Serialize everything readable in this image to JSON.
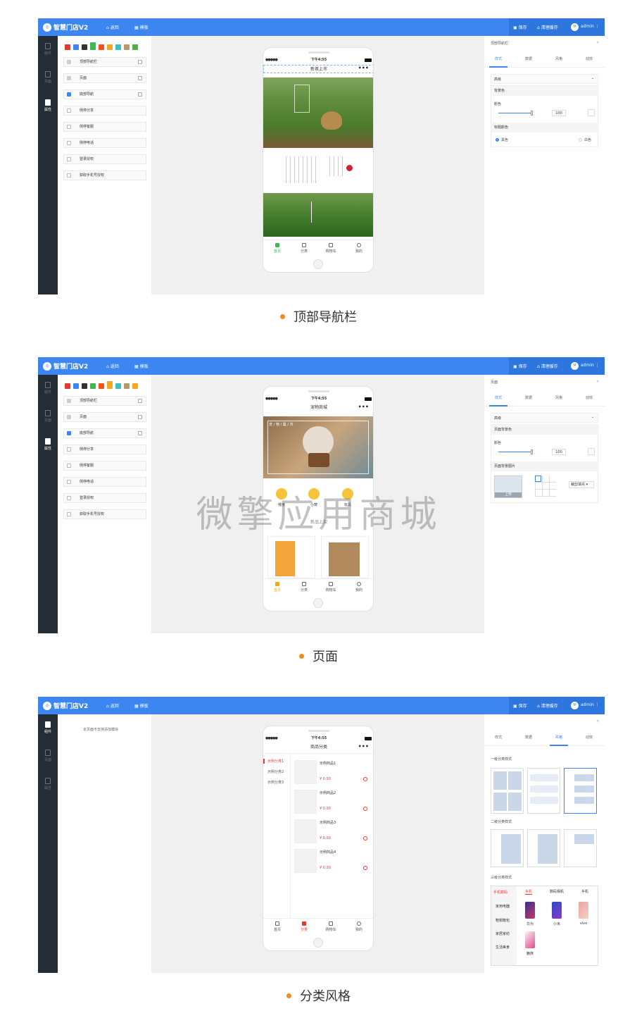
{
  "app": {
    "logo": "智慧门店V2",
    "nav_back": "返回",
    "nav_template": "模板",
    "save": "保存",
    "clear_cache": "清理缓存",
    "user": "admin"
  },
  "sidebar": {
    "components": "组件",
    "page": "页面",
    "properties": "属性"
  },
  "swatches": [
    "#e03b2d",
    "#3d86f1",
    "#333333",
    "#3fb84f",
    "#f2531e",
    "#f5a623",
    "#3dc1bf",
    "#8bc34a",
    "#b59a6d",
    "#4caf50"
  ],
  "options": [
    "顶部导航栏",
    "页面",
    "底部导航",
    "侧停分享",
    "侧停客服",
    "侧停电话",
    "登录授权",
    "获取手机号授权"
  ],
  "empty_note": "本页面不支持添加模块",
  "phone": {
    "time": "下午4:55",
    "dots": "•••",
    "title1": "新茶上市",
    "title2": "宠物商城",
    "title3": "商品分类",
    "pet_label": "宠 / 物 / 集 / 市",
    "pet_items": [
      "喂食",
      "小窝",
      "玩具"
    ],
    "new_label": "新品上架"
  },
  "tabs": {
    "home": "首页",
    "category": "分类",
    "cart": "购物车",
    "mine": "我的"
  },
  "cats": [
    "示例分类1",
    "示例分类2",
    "示例分类3"
  ],
  "products": [
    {
      "name": "示例商品1",
      "price": "¥ 0.00"
    },
    {
      "name": "示例商品2",
      "price": "¥ 0.00"
    },
    {
      "name": "示例商品3",
      "price": "¥ 0.00"
    },
    {
      "name": "示例商品4",
      "price": "¥ 0.00"
    }
  ],
  "right": {
    "title1": "顶部导航栏",
    "title2": "页面",
    "tabs": [
      "样式",
      "数据",
      "风格",
      "动效"
    ],
    "collapse": "高级",
    "bg_color": "背景色",
    "page_bg_color": "页面背景色",
    "color": "颜色",
    "value": "100",
    "title_color": "标题颜色",
    "black": "黑色",
    "white": "白色",
    "page_bg_image": "页面背景图片",
    "upload": "上传",
    "fill_mode": "裁剪填充",
    "level1": "一级分类样式",
    "level2": "二级分类样式",
    "level3": "三级分类样式"
  },
  "level3": {
    "side": [
      "手机数码",
      "家用电器",
      "鞋帽箱包",
      "家居家纺",
      "生活美食"
    ],
    "tabs": [
      "手机",
      "数码相机",
      "手机"
    ],
    "phones": [
      "华为",
      "小米",
      "vivo",
      "魅族"
    ]
  },
  "captions": [
    "顶部导航栏",
    "页面",
    "分类风格"
  ],
  "watermark": "微擎应用商城"
}
